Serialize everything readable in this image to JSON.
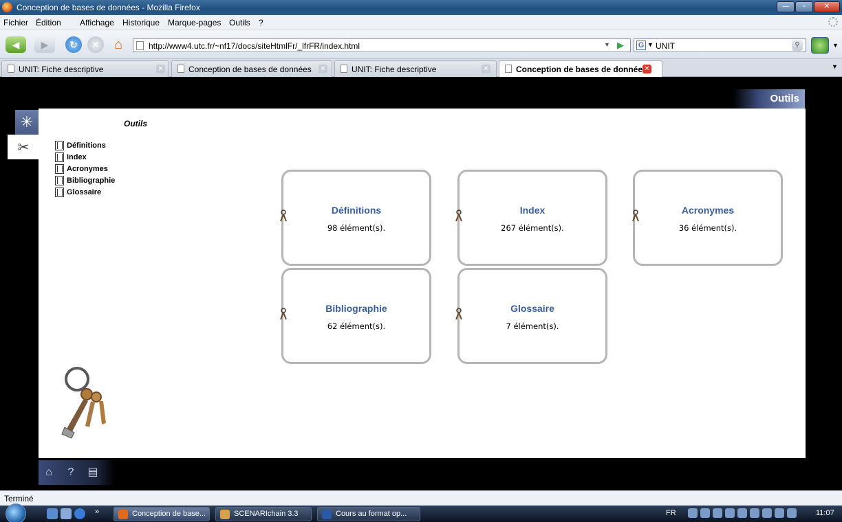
{
  "window": {
    "title": "Conception de bases de données - Mozilla Firefox",
    "minimize_label": "—",
    "maximize_label": "▫",
    "close_label": "✕"
  },
  "menu": {
    "items": [
      "Fichier",
      "Édition",
      "Affichage",
      "Historique",
      "Marque-pages",
      "Outils",
      "?"
    ]
  },
  "navbar": {
    "url": "http://www4.utc.fr/~nf17/docs/siteHtmlFr/_lfrFR/index.html",
    "search_engine": "G",
    "search_text": "UNIT"
  },
  "tabs": [
    {
      "label": "UNIT: Fiche descriptive",
      "active": false
    },
    {
      "label": "Conception de bases de données",
      "active": false
    },
    {
      "label": "UNIT: Fiche descriptive",
      "active": false
    },
    {
      "label": "Conception de bases de données",
      "active": true
    }
  ],
  "page": {
    "header_tab": "Outils",
    "section_heading": "Outils",
    "tree": [
      "Définitions",
      "Index",
      "Acronymes",
      "Bibliographie",
      "Glossaire"
    ],
    "cards": [
      {
        "title": "Définitions",
        "count": "98 élément(s)."
      },
      {
        "title": "Index",
        "count": "267 élément(s)."
      },
      {
        "title": "Acronymes",
        "count": "36 élément(s)."
      },
      {
        "title": "Bibliographie",
        "count": "62 élément(s)."
      },
      {
        "title": "Glossaire",
        "count": "7 élément(s)."
      }
    ],
    "bottom_tools": [
      "home-icon",
      "help-icon",
      "print-icon"
    ]
  },
  "status": {
    "text": "Terminé"
  },
  "taskbar": {
    "more": "»",
    "tasks": [
      {
        "label": "Conception de base...",
        "active": true,
        "color": "#e06a1a"
      },
      {
        "label": "SCENARIchain 3.3",
        "active": false,
        "color": "#d8a04a"
      },
      {
        "label": "Cours au format op...",
        "active": false,
        "color": "#2a5aa6"
      }
    ],
    "lang": "FR",
    "clock": "11:07"
  }
}
